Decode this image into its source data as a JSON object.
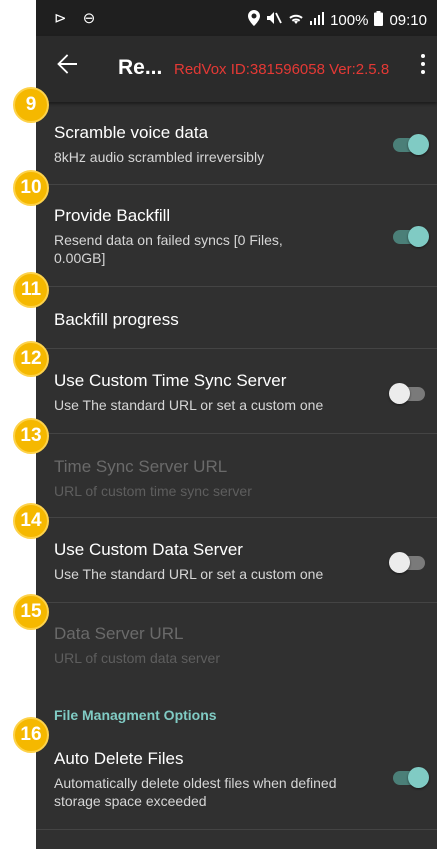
{
  "status_bar": {
    "left_icons": "⊳ ⊖",
    "battery": "100%",
    "time": "09:10"
  },
  "app_bar": {
    "title": "Re...",
    "info": "RedVox ID:381596058 Ver:2.5.8"
  },
  "settings": [
    {
      "number": "9",
      "title": "Scramble voice data",
      "subtitle": "8kHz audio scrambled irreversibly",
      "toggle": "on",
      "enabled": true
    },
    {
      "number": "10",
      "title": "Provide Backfill",
      "subtitle": "Resend data on failed syncs [0 Files,  0.00GB]",
      "toggle": "on",
      "enabled": true
    },
    {
      "number": "11",
      "title": "Backfill progress",
      "subtitle": "",
      "toggle": null,
      "enabled": true
    },
    {
      "number": "12",
      "title": "Use Custom Time Sync Server",
      "subtitle": "Use The standard URL or set a custom one",
      "toggle": "off",
      "enabled": true
    },
    {
      "number": "13",
      "title": "Time Sync Server URL",
      "subtitle": "URL of custom time sync server",
      "toggle": null,
      "enabled": false
    },
    {
      "number": "14",
      "title": "Use Custom Data Server",
      "subtitle": "Use The standard URL or set a custom one",
      "toggle": "off",
      "enabled": true
    },
    {
      "number": "15",
      "title": "Data Server URL",
      "subtitle": "URL of custom data server",
      "toggle": null,
      "enabled": false
    },
    {
      "number": "16",
      "title": "Auto Delete Files",
      "subtitle": "Automatically delete oldest files when defined storage space exceeded",
      "toggle": "on",
      "enabled": true
    }
  ],
  "section_header": "File Managment Options",
  "colors": {
    "background": "#303030",
    "accent": "#80cbc4",
    "info_red": "#e53935",
    "badge": "#f5b800"
  }
}
